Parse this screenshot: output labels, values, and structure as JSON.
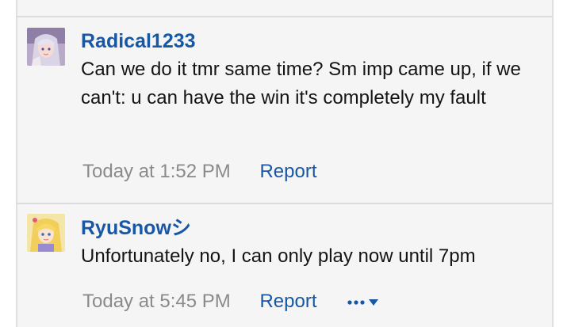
{
  "posts": [
    {
      "username": "Radical1233",
      "message": "Can we do it tmr same time? Sm imp came up, if we can't: u can have the win it's completely my fault",
      "timestamp": "Today at 1:52 PM",
      "report_label": "Report",
      "avatar_icon": "anime-avatar-silver-hair"
    },
    {
      "username": "RyuSnowシ",
      "message": "Unfortunately no, I can only play now until 7pm",
      "timestamp": "Today at 5:45 PM",
      "report_label": "Report",
      "avatar_icon": "anime-avatar-blonde-hair"
    }
  ],
  "colors": {
    "link": "#1857a6",
    "timestamp": "#8a8a8a",
    "text": "#141414",
    "background": "#f5f5f5"
  }
}
